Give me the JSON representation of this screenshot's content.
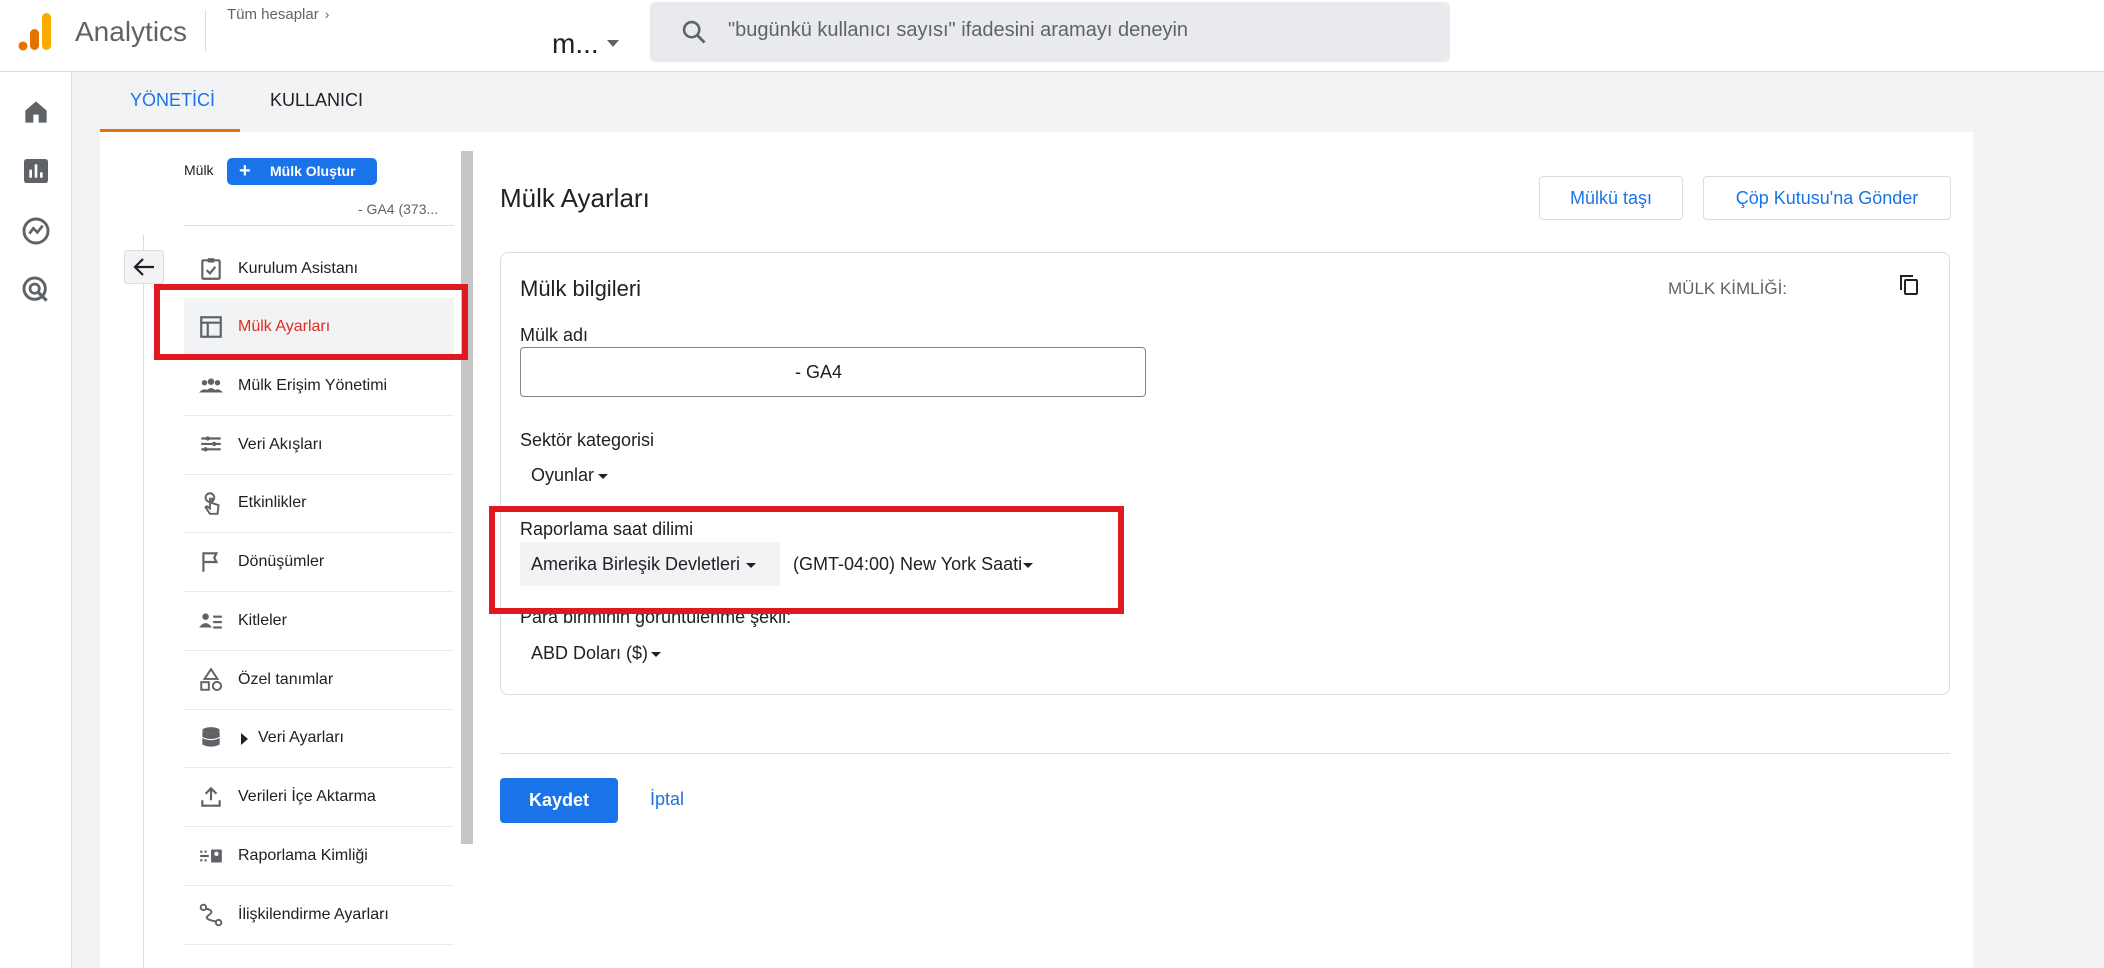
{
  "header": {
    "app_name": "Analytics",
    "breadcrumb": "Tüm hesaplar",
    "account_name": "m...",
    "search_placeholder": "\"bugünkü kullanıcı sayısı\" ifadesini aramayı deneyin"
  },
  "tabs": [
    {
      "label": "YÖNETİCİ",
      "active": true
    },
    {
      "label": "KULLANICI",
      "active": false
    }
  ],
  "left_rail": [
    "home-icon",
    "reports-icon",
    "explore-icon",
    "advertising-icon"
  ],
  "property_column": {
    "label": "Mülk",
    "create_button": "Mülk Oluştur",
    "selected_property": "- GA4 (373..."
  },
  "nav": {
    "items": [
      {
        "label": "Kurulum Asistanı",
        "icon": "checklist-icon"
      },
      {
        "label": "Mülk Ayarları",
        "icon": "layout-icon",
        "selected": true
      },
      {
        "label": "Mülk Erişim Yönetimi",
        "icon": "people-icon"
      },
      {
        "label": "Veri Akışları",
        "icon": "streams-icon"
      },
      {
        "label": "Etkinlikler",
        "icon": "touch-icon"
      },
      {
        "label": "Dönüşümler",
        "icon": "flag-icon"
      },
      {
        "label": "Kitleler",
        "icon": "audience-icon"
      },
      {
        "label": "Özel tanımlar",
        "icon": "shapes-icon"
      },
      {
        "label": "Veri Ayarları",
        "icon": "database-icon"
      },
      {
        "label": "Verileri İçe Aktarma",
        "icon": "upload-icon"
      },
      {
        "label": "Raporlama Kimliği",
        "icon": "id-icon"
      },
      {
        "label": "İlişkilendirme Ayarları",
        "icon": "attribution-icon"
      }
    ]
  },
  "main": {
    "title": "Mülk Ayarları",
    "move_button": "Mülkü taşı",
    "trash_button": "Çöp Kutusu'na Gönder",
    "card_title": "Mülk bilgileri",
    "property_id_label": "MÜLK KİMLİĞİ:",
    "name_label": "Mülk adı",
    "name_value": "- GA4",
    "industry_label": "Sektör kategorisi",
    "industry_value": "Oyunlar",
    "timezone_label": "Raporlama saat dilimi",
    "timezone_country": "Amerika Birleşik Devletleri",
    "timezone_value": "(GMT-04:00) New York Saati",
    "currency_label": "Para biriminin görüntülenme şekli:",
    "currency_value": "ABD Doları ($)",
    "save_button": "Kaydet",
    "cancel_button": "İptal"
  },
  "colors": {
    "accent": "#1a73e8",
    "highlight_box": "#e0181f",
    "tab_underline": "#e8710a"
  }
}
